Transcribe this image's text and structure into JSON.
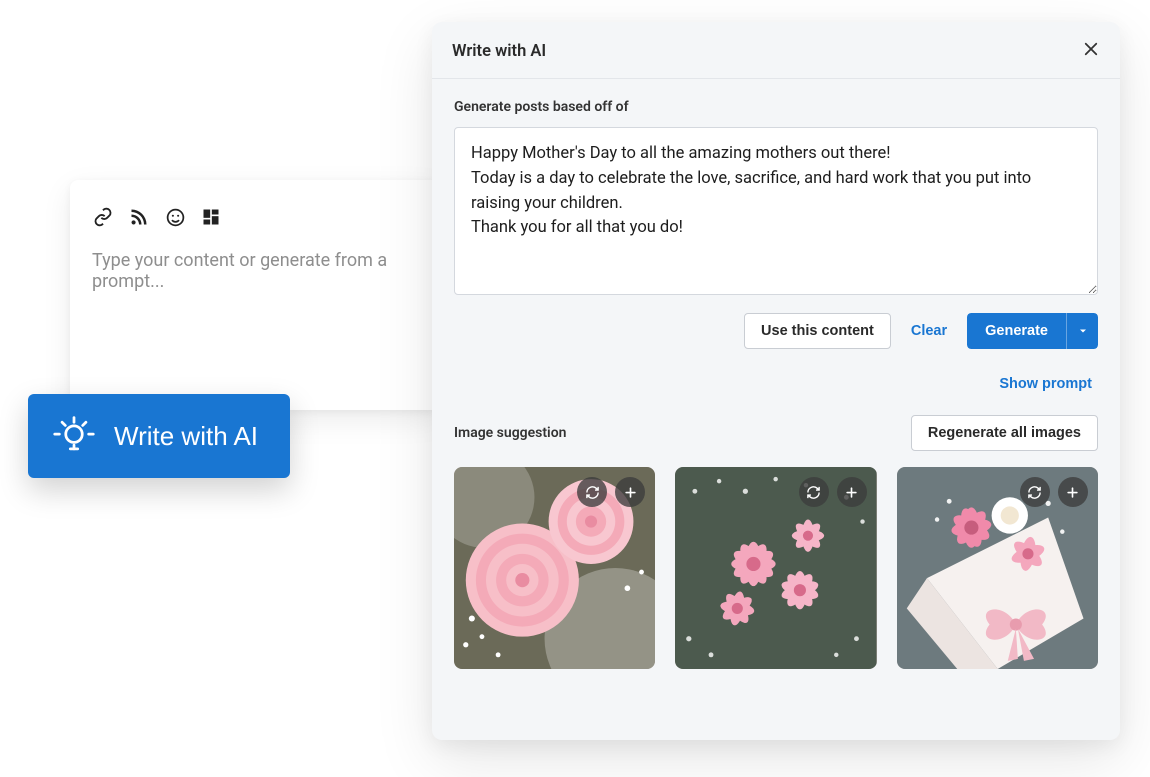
{
  "composer": {
    "placeholder": "Type your content or generate from a prompt..."
  },
  "write_button": {
    "label": "Write with AI"
  },
  "ai_panel": {
    "title": "Write with AI",
    "prompt_label": "Generate posts based off of",
    "prompt_value": "Happy Mother's Day to all the amazing mothers out there!\nToday is a day to celebrate the love, sacrifice, and hard work that you put into raising your children.\nThank you for all that you do!",
    "use_content_label": "Use this content",
    "clear_label": "Clear",
    "generate_label": "Generate",
    "show_prompt_label": "Show prompt",
    "image_suggestion_label": "Image suggestion",
    "regenerate_label": "Regenerate all images",
    "thumbnails": [
      {
        "alt": "pink ranunculus bouquet"
      },
      {
        "alt": "pink daisies with baby's breath bouquet"
      },
      {
        "alt": "wrapped bouquet with pink gerberas and ribbon"
      }
    ]
  },
  "colors": {
    "primary": "#1976d2"
  }
}
